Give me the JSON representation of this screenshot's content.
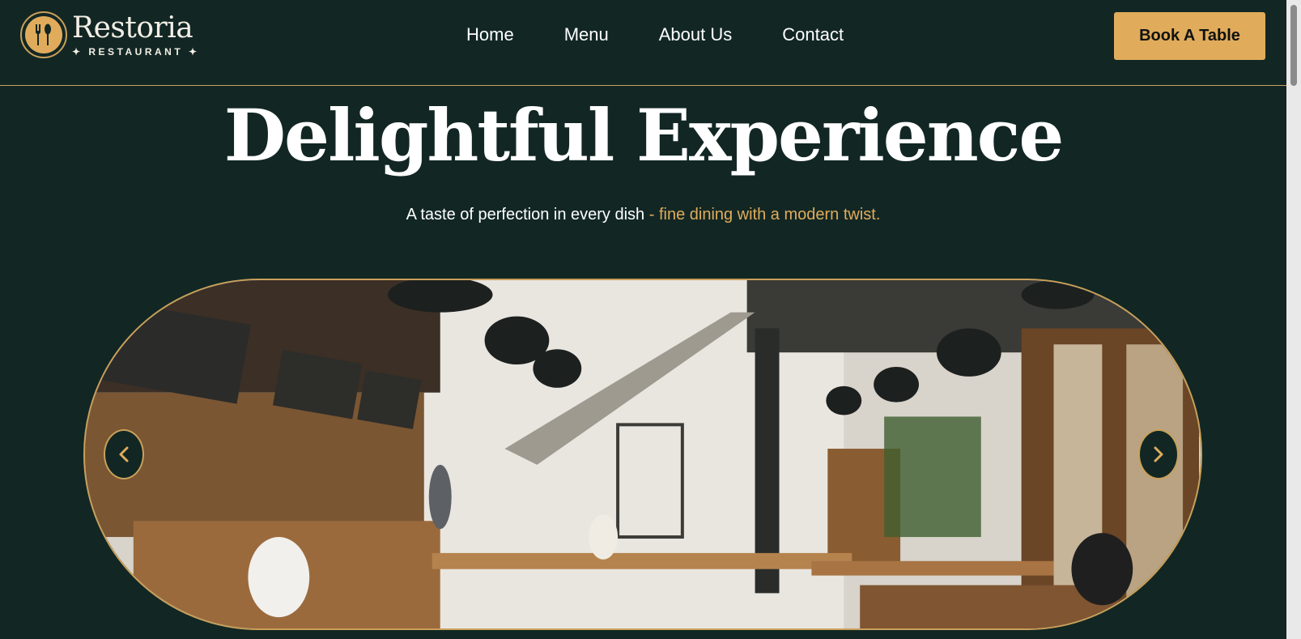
{
  "brand": {
    "name": "Restoria",
    "tagline": "✦ RESTAURANT ✦"
  },
  "nav": {
    "items": [
      {
        "label": "Home"
      },
      {
        "label": "Menu"
      },
      {
        "label": "About Us"
      },
      {
        "label": "Contact"
      }
    ]
  },
  "cta": {
    "label": "Book A Table"
  },
  "hero": {
    "title": "Delightful Experience",
    "subtitle_main": "A taste of perfection in every dish",
    "subtitle_accent": " - fine dining with a modern twist."
  },
  "slider": {
    "prev_icon": "chevron-left-icon",
    "next_icon": "chevron-right-icon",
    "image": "restaurant-interior-photo"
  },
  "colors": {
    "background": "#122724",
    "accent": "#e0ac5c",
    "text": "#ffffff"
  }
}
